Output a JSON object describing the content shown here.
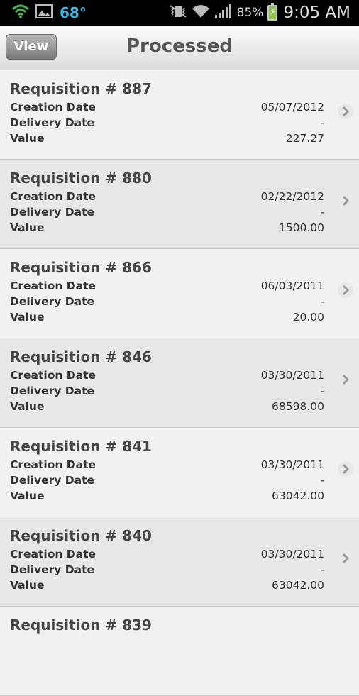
{
  "status_bar": {
    "temperature": "68°",
    "battery_percent": "85%",
    "time": "9:05 AM",
    "accent_color": "#33b5e5"
  },
  "header": {
    "view_button": "View",
    "title": "Processed"
  },
  "labels": {
    "creation_date": "Creation Date",
    "delivery_date": "Delivery Date",
    "value": "Value"
  },
  "requisitions": [
    {
      "title": "Requisition # 887",
      "creation_date": "05/07/2012",
      "delivery_date": "-",
      "value": "227.27"
    },
    {
      "title": "Requisition # 880",
      "creation_date": "02/22/2012",
      "delivery_date": "-",
      "value": "1500.00"
    },
    {
      "title": "Requisition # 866",
      "creation_date": "06/03/2011",
      "delivery_date": "-",
      "value": "20.00"
    },
    {
      "title": "Requisition # 846",
      "creation_date": "03/30/2011",
      "delivery_date": "-",
      "value": "68598.00"
    },
    {
      "title": "Requisition # 841",
      "creation_date": "03/30/2011",
      "delivery_date": "-",
      "value": "63042.00"
    },
    {
      "title": "Requisition # 840",
      "creation_date": "03/30/2011",
      "delivery_date": "-",
      "value": "63042.00"
    },
    {
      "title": "Requisition # 839"
    }
  ]
}
